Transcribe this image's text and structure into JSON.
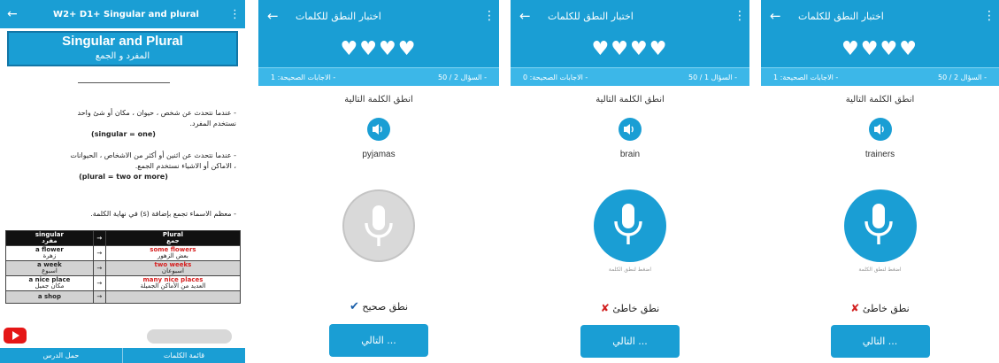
{
  "lesson": {
    "title": "W2+ D1+ Singular and plural",
    "banner_en": "Singular and Plural",
    "banner_ar": "المفرد و الجمع",
    "para_a_line1": "- عندما نتحدث عن شخص ، حيوان ، مكان أو شئ واحد",
    "para_a_line2": "نستخدم المفرد.",
    "para_a_rule": "(singular = one)",
    "para_b_line1": "- عندما نتحدث عن اثنين أو أكثر من الاشخاص ، الحيوانات",
    "para_b_line2": "، الاماكن أو الاشياء نستخدم الجمع.",
    "para_b_rule": "(plural = two or more)",
    "para_c": "- معظم الاسماء تجمع بإضافة (s) في نهاية الكلمة.",
    "table": {
      "head_singular_en": "singular",
      "head_singular_ar": "مفرد",
      "head_plural_en": "Plural",
      "head_plural_ar": "جمع",
      "rows": [
        {
          "s_en": "a flower",
          "s_ar": "زهرة",
          "p_en": "some flowers",
          "p_ar": "بعض الزهور"
        },
        {
          "s_en": "a week",
          "s_ar": "اسبوع",
          "p_en": "two weeks",
          "p_ar": "اسبوعان"
        },
        {
          "s_en": "a nice place",
          "s_ar": "مكان جميل",
          "p_en": "many nice places",
          "p_ar": "العديد من الأماكن الجميلة"
        },
        {
          "s_en": "a shop",
          "s_ar": "",
          "p_en": "",
          "p_ar": ""
        }
      ]
    },
    "bottom_left": "حمل الدرس",
    "bottom_right": "قائمة الكلمات"
  },
  "quiz_title": "اختبار النطق للكلمات",
  "hearts": "♥♥♥♥",
  "prompt": "انطق الكلمة التالية",
  "next_label": "... التالي",
  "mic_hint": "اضغط لنطق الكلمة",
  "screens": [
    {
      "question": "السؤال 2 / 50 -",
      "correct": "الاجابات الصحيحة: 1 -",
      "word": "pyjamas",
      "result": "نطق صحيح",
      "mic_state": "disabled"
    },
    {
      "question": "السؤال 1 / 50 -",
      "correct": "الاجابات الصحيحة: 0 -",
      "word": "brain",
      "result": "نطق خاطئ",
      "mic_state": "active"
    },
    {
      "question": "السؤال 2 / 50 -",
      "correct": "الاجابات الصحيحة: 1 -",
      "word": "trainers",
      "result": "نطق خاطئ",
      "mic_state": "active"
    }
  ],
  "colors": {
    "primary": "#1a9ed4",
    "score_bar": "#3cb7e8",
    "error": "#d21f1f",
    "ok_mark": "#1a5faa"
  },
  "icons": [
    "back-arrow-icon",
    "more-vert-icon",
    "speaker-icon",
    "microphone-icon",
    "check-icon",
    "cross-icon",
    "youtube-icon"
  ]
}
